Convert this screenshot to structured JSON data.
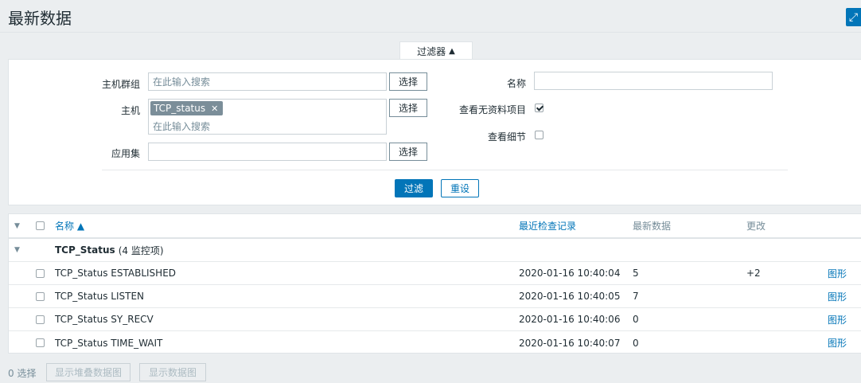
{
  "page": {
    "title": "最新数据",
    "fullscreen_icon": "expand-icon"
  },
  "filter": {
    "tab_label": "过滤器",
    "host_group_label": "主机群组",
    "host_group_placeholder": "在此输入搜索",
    "host_label": "主机",
    "host_tag": "TCP_status",
    "host_placeholder": "在此输入搜索",
    "application_label": "应用集",
    "application_value": "",
    "select_label": "选择",
    "name_label": "名称",
    "name_value": "",
    "show_no_data_label": "查看无资料项目",
    "show_no_data_checked": true,
    "show_details_label": "查看细节",
    "show_details_checked": false,
    "filter_button": "过滤",
    "reset_button": "重设"
  },
  "table": {
    "columns": {
      "name": "名称 ▲",
      "last_check": "最近检查记录",
      "last_value": "最新数据",
      "change": "更改"
    },
    "group": {
      "name": "TCP_Status",
      "count": "(4 监控项)"
    },
    "rows": [
      {
        "name": "TCP_Status ESTABLISHED",
        "last_check": "2020-01-16 10:40:04",
        "value": "5",
        "change": "+2",
        "link": "图形"
      },
      {
        "name": "TCP_Status LISTEN",
        "last_check": "2020-01-16 10:40:05",
        "value": "7",
        "change": "",
        "link": "图形"
      },
      {
        "name": "TCP_Status SY_RECV",
        "last_check": "2020-01-16 10:40:06",
        "value": "0",
        "change": "",
        "link": "图形"
      },
      {
        "name": "TCP_Status TIME_WAIT",
        "last_check": "2020-01-16 10:40:07",
        "value": "0",
        "change": "",
        "link": "图形"
      }
    ]
  },
  "footer": {
    "selected": "0 选择",
    "stacked_graph": "显示堆叠数据图",
    "graph": "显示数据图"
  }
}
